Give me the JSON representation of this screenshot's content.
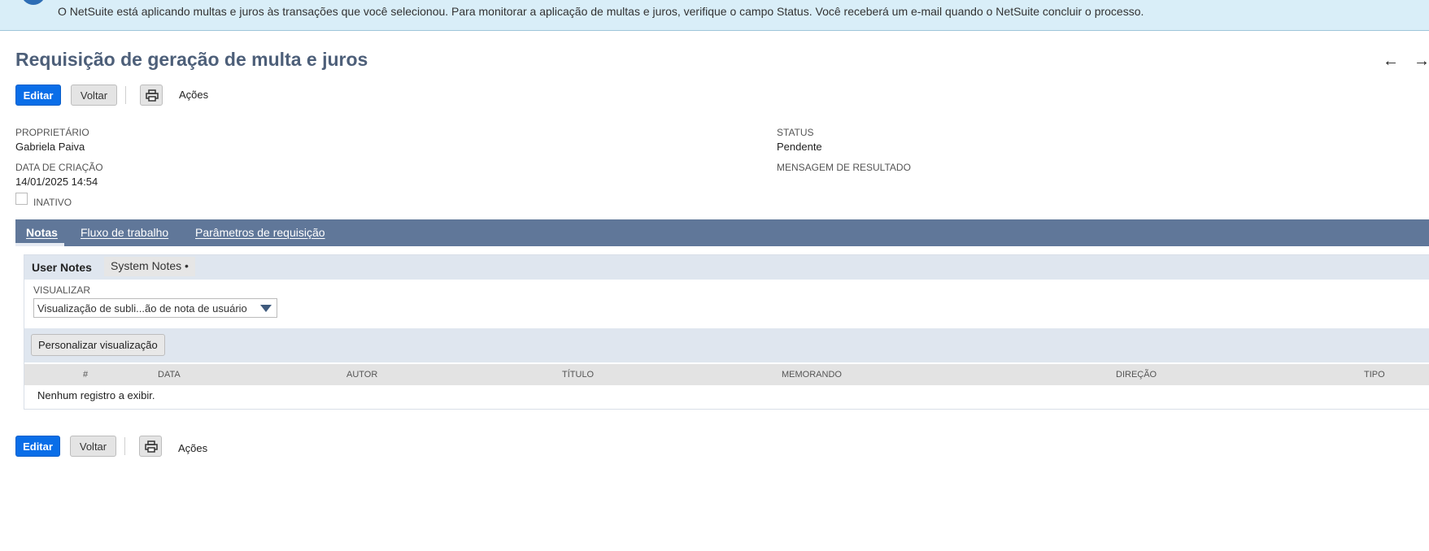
{
  "banner": {
    "message": "O NetSuite está aplicando multas e juros às transações que você selecionou. Para monitorar a aplicação de multas e juros, verifique o campo Status. Você receberá um e-mail quando o NetSuite concluir o processo."
  },
  "page": {
    "title": "Requisição de geração de multa e juros",
    "prev_arrow": "←",
    "next_arrow": "→"
  },
  "toolbar": {
    "edit_label": "Editar",
    "back_label": "Voltar",
    "actions_label": "Ações"
  },
  "fields": {
    "owner_label": "PROPRIETÁRIO",
    "owner_value": "Gabriela Paiva",
    "created_label": "DATA DE CRIAÇÃO",
    "created_value": "14/01/2025 14:54",
    "inactive_label": "INATIVO",
    "status_label": "STATUS",
    "status_value": "Pendente",
    "result_label": "MENSAGEM DE RESULTADO"
  },
  "tabs": [
    {
      "label": "Notas"
    },
    {
      "label": "Fluxo de trabalho"
    },
    {
      "label": "Parâmetros de requisição"
    }
  ],
  "subtabs": [
    {
      "label": "User Notes"
    },
    {
      "label": "System Notes •"
    }
  ],
  "view": {
    "label": "VISUALIZAR",
    "selected": "Visualização de subli...ão de nota de usuário",
    "customize_label": "Personalizar visualização"
  },
  "grid": {
    "columns": [
      "#",
      "DATA",
      "AUTOR",
      "TÍTULO",
      "MEMORANDO",
      "DIREÇÃO",
      "TIPO"
    ],
    "empty_message": "Nenhum registro a exibir."
  },
  "icons": {
    "info": "info-icon",
    "print": "printer-icon",
    "dropdown": "chevron-down-icon"
  }
}
